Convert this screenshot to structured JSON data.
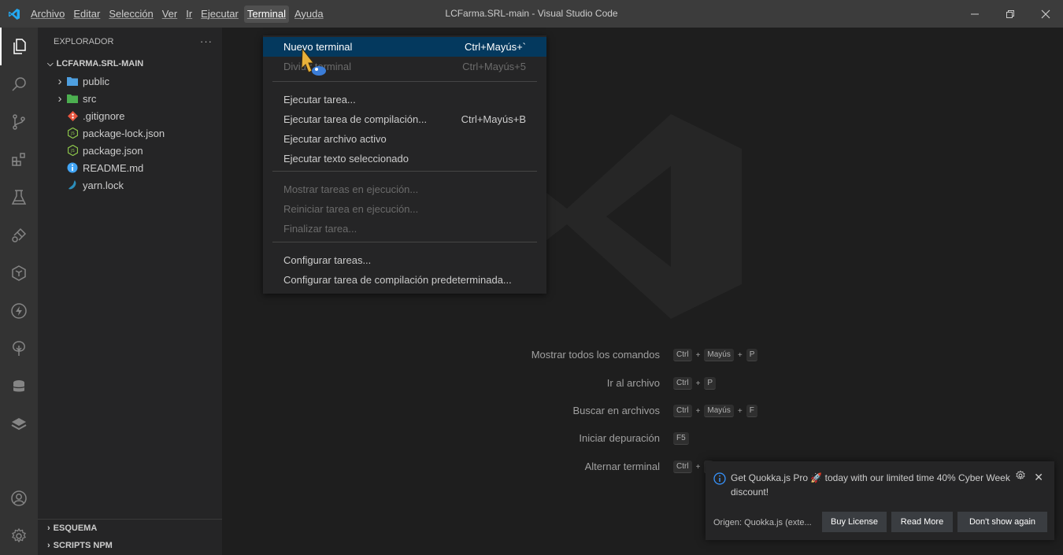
{
  "window": {
    "title": "LCFarma.SRL-main - Visual Studio Code",
    "controls": [
      "minimize-icon",
      "restore-icon",
      "close-icon"
    ]
  },
  "menubar": {
    "items": [
      {
        "label": "Archivo",
        "mnemonic": "A"
      },
      {
        "label": "Editar",
        "mnemonic": "E"
      },
      {
        "label": "Selección",
        "mnemonic": "S"
      },
      {
        "label": "Ver",
        "mnemonic": "V"
      },
      {
        "label": "Ir",
        "mnemonic": "I"
      },
      {
        "label": "Ejecutar",
        "mnemonic": "j"
      },
      {
        "label": "Terminal",
        "mnemonic": "T"
      },
      {
        "label": "Ayuda",
        "mnemonic": "A"
      }
    ],
    "active": "Terminal"
  },
  "activitybar": {
    "icons": [
      "explorer-icon",
      "search-icon",
      "source-control-icon",
      "extensions-icon",
      "testing-icon",
      "remote-explorer-icon",
      "containers-icon",
      "thunder-icon",
      "tree-icon",
      "database-icon",
      "stack-icon",
      "account-icon",
      "manage-gear-icon"
    ]
  },
  "sidebar": {
    "title": "EXPLORADOR",
    "more": "···",
    "root": "LCFARMA.SRL-MAIN",
    "items": [
      {
        "label": "public",
        "type": "folder",
        "icon": "folder-public-icon",
        "color": "#4e9fe0"
      },
      {
        "label": "src",
        "type": "folder",
        "icon": "folder-src-icon",
        "color": "#4caf50"
      },
      {
        "label": ".gitignore",
        "type": "file",
        "icon": "git-icon",
        "color": "#e8553e"
      },
      {
        "label": "package-lock.json",
        "type": "file",
        "icon": "nodejs-icon",
        "color": "#8bc34a"
      },
      {
        "label": "package.json",
        "type": "file",
        "icon": "nodejs-icon",
        "color": "#8bc34a"
      },
      {
        "label": "README.md",
        "type": "file",
        "icon": "info-icon",
        "color": "#42a5f5"
      },
      {
        "label": "yarn.lock",
        "type": "file",
        "icon": "yarn-icon",
        "color": "#2c8ebb"
      }
    ],
    "bottom_sections": [
      "ESQUEMA",
      "SCRIPTS NPM"
    ]
  },
  "terminal_menu": {
    "items": [
      {
        "label": "Nuevo terminal",
        "shortcut": "Ctrl+Mayús+`",
        "state": "highlighted"
      },
      {
        "label": "Dividir terminal",
        "shortcut": "Ctrl+Mayús+5",
        "state": "disabled"
      },
      {
        "label": "Ejecutar tarea...",
        "shortcut": "",
        "state": "normal"
      },
      {
        "label": "Ejecutar tarea de compilación...",
        "shortcut": "Ctrl+Mayús+B",
        "state": "normal"
      },
      {
        "label": "Ejecutar archivo activo",
        "shortcut": "",
        "state": "normal"
      },
      {
        "label": "Ejecutar texto seleccionado",
        "shortcut": "",
        "state": "normal"
      },
      {
        "label": "Mostrar tareas en ejecución...",
        "shortcut": "",
        "state": "disabled"
      },
      {
        "label": "Reiniciar tarea en ejecución...",
        "shortcut": "",
        "state": "disabled"
      },
      {
        "label": "Finalizar tarea...",
        "shortcut": "",
        "state": "disabled"
      },
      {
        "label": "Configurar tareas...",
        "shortcut": "",
        "state": "normal"
      },
      {
        "label": "Configurar tarea de compilación predeterminada...",
        "shortcut": "",
        "state": "normal"
      }
    ]
  },
  "welcome_shortcuts": [
    {
      "label": "Mostrar todos los comandos",
      "keys": [
        "Ctrl",
        "Mayús",
        "P"
      ]
    },
    {
      "label": "Ir al archivo",
      "keys": [
        "Ctrl",
        "P"
      ]
    },
    {
      "label": "Buscar en archivos",
      "keys": [
        "Ctrl",
        "Mayús",
        "F"
      ]
    },
    {
      "label": "Iniciar depuración",
      "keys": [
        "F5"
      ]
    },
    {
      "label": "Alternar terminal",
      "keys": [
        "Ctrl",
        "`"
      ]
    }
  ],
  "notification": {
    "message": "Get Quokka.js Pro 🚀 today with our limited time 40% Cyber Week discount!",
    "source": "Origen: Quokka.js (exte...",
    "buttons": [
      "Buy License",
      "Read More",
      "Don't show again"
    ]
  },
  "colors": {
    "titlebar": "#3c3c3c",
    "activitybar": "#333333",
    "sidebar": "#252526",
    "editor": "#1e1e1e",
    "menu_highlight": "#04395e",
    "vscode_blue": "#23a9f2"
  }
}
